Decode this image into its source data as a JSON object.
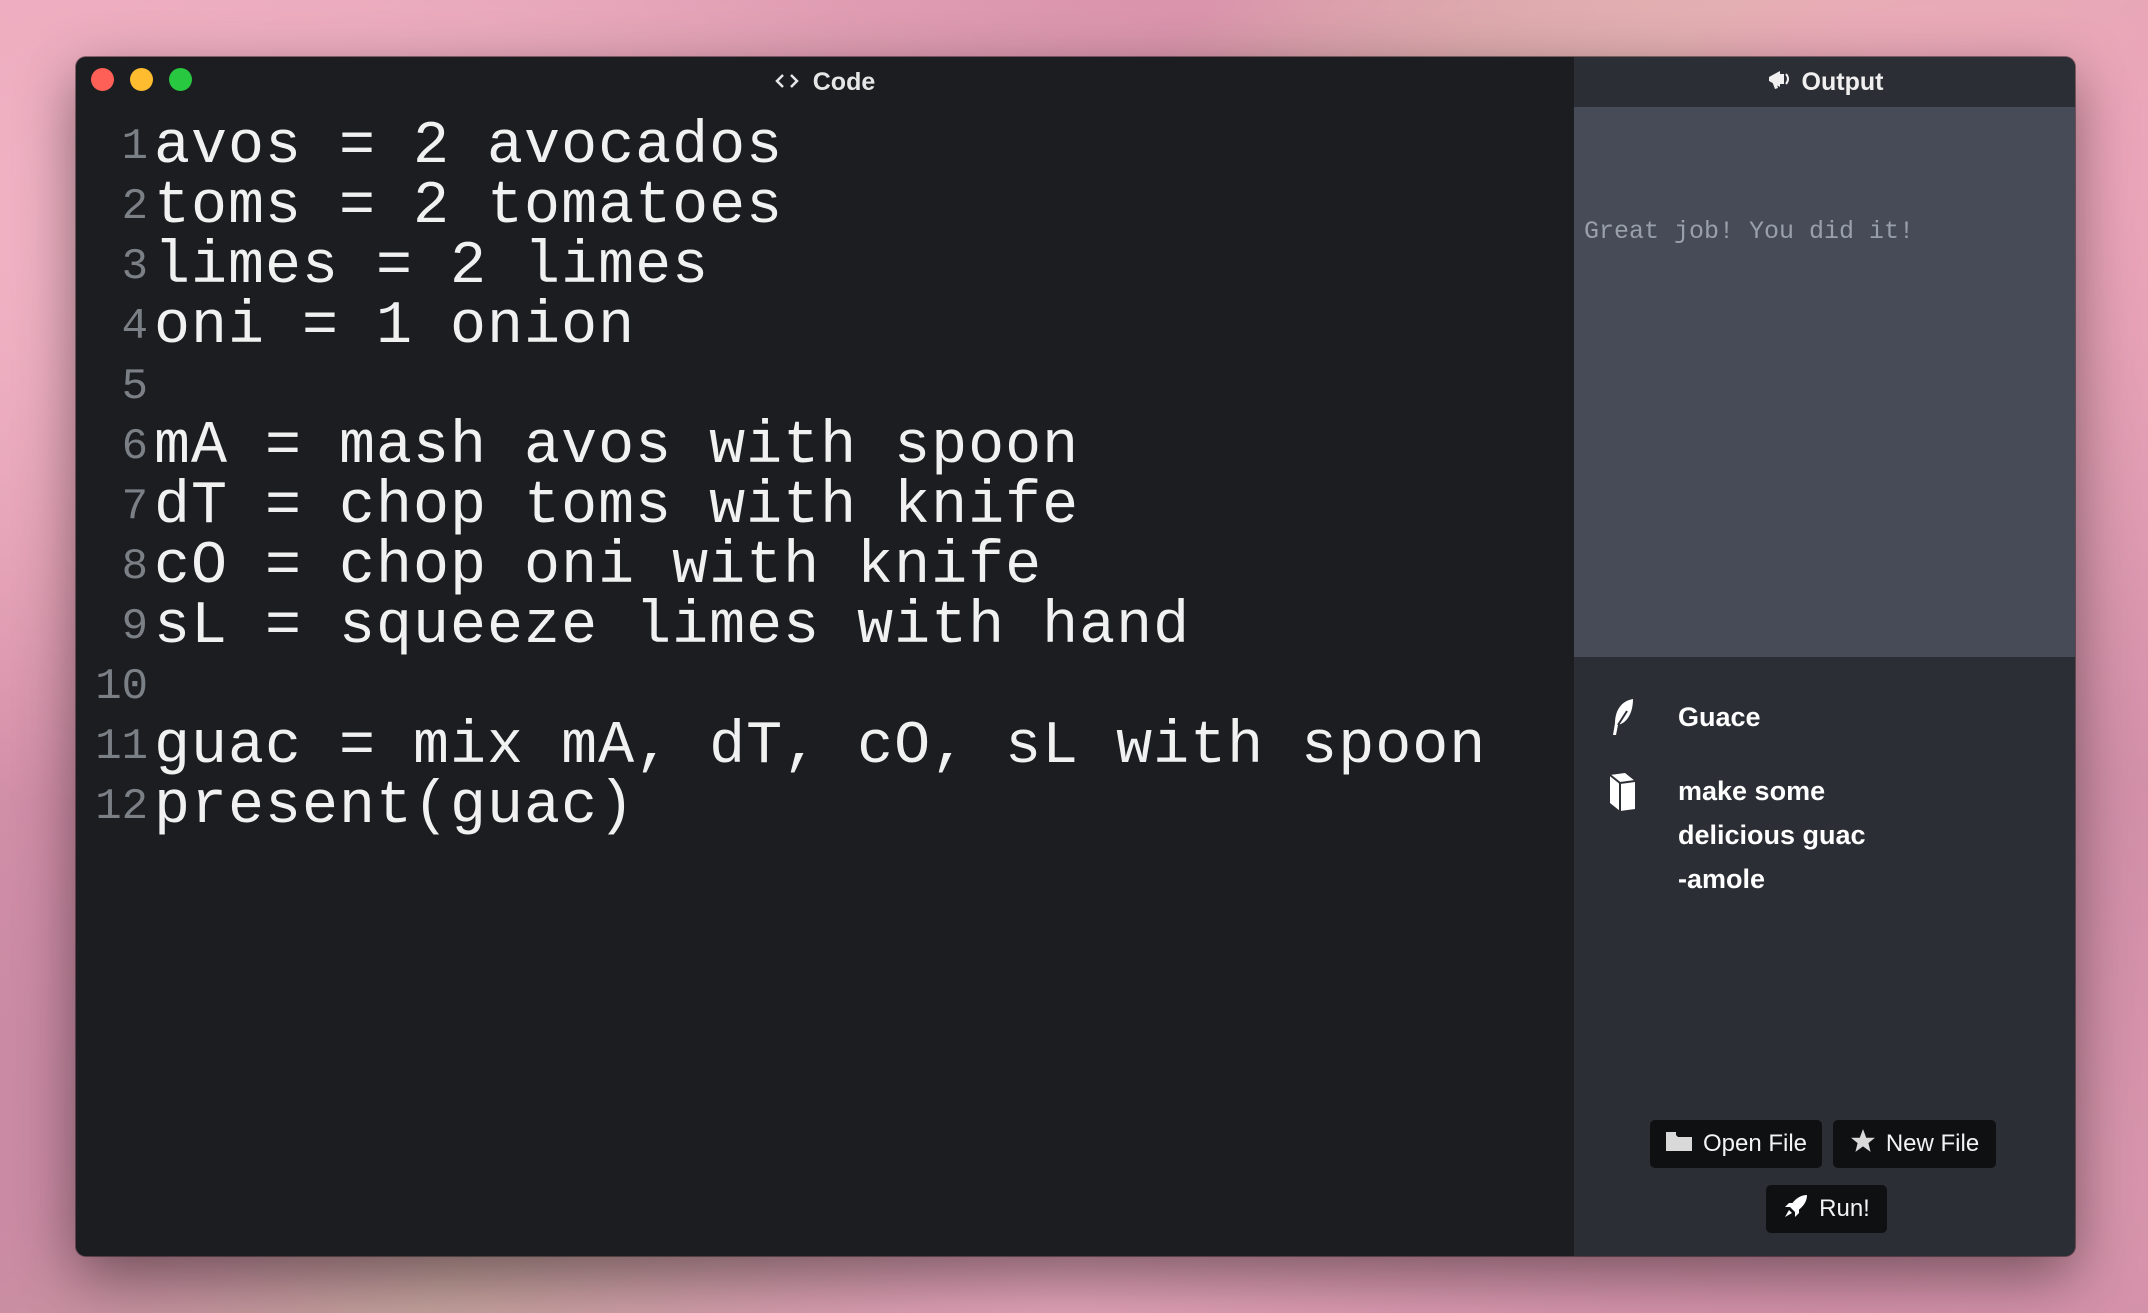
{
  "editor": {
    "title": "Code",
    "lines": [
      {
        "num": "1",
        "code": "avos = 2 avocados"
      },
      {
        "num": "2",
        "code": "toms = 2 tomatoes"
      },
      {
        "num": "3",
        "code": "limes = 2 limes"
      },
      {
        "num": "4",
        "code": "oni = 1 onion"
      },
      {
        "num": "5",
        "code": ""
      },
      {
        "num": "6",
        "code": "mA = mash avos with spoon"
      },
      {
        "num": "7",
        "code": "dT = chop toms with knife"
      },
      {
        "num": "8",
        "code": "cO = chop oni with knife"
      },
      {
        "num": "9",
        "code": "sL = squeeze limes with hand"
      },
      {
        "num": "10",
        "code": ""
      },
      {
        "num": "11",
        "code": "guac = mix mA, dT, cO, sL with spoon"
      },
      {
        "num": "12",
        "code": "present(guac)"
      }
    ]
  },
  "output": {
    "title": "Output",
    "text": "Great job! You did it!"
  },
  "meta": {
    "name": "Guace",
    "description": "make some delicious guac -amole"
  },
  "buttons": {
    "open_file": "Open File",
    "new_file": "New File",
    "run": "Run!"
  },
  "icons": {
    "code": "code-brackets-icon",
    "output": "megaphone-icon",
    "name": "feather-icon",
    "description": "book-icon",
    "open": "folder-icon",
    "new": "star-icon",
    "run": "rocket-icon"
  },
  "colors": {
    "editor_bg": "#1b1d21",
    "output_bg": "#464b57",
    "side_bg": "#2b2e34",
    "button_bg": "#0f1012",
    "close": "#fe5f57",
    "minimize": "#febc2e",
    "zoom": "#28c840"
  }
}
